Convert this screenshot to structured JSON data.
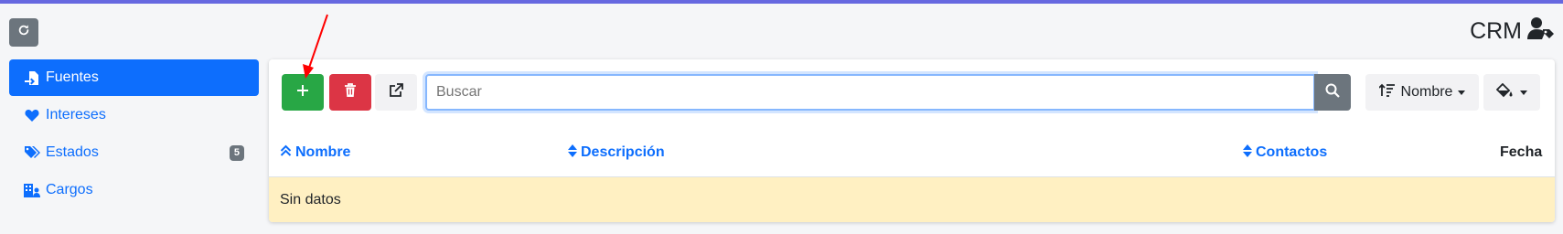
{
  "header": {
    "title": "CRM",
    "refresh_icon": "refresh-icon",
    "user_tag_icon": "user-tag-icon"
  },
  "sidebar": {
    "items": [
      {
        "label": "Fuentes",
        "icon": "file-import-icon",
        "active": true
      },
      {
        "label": "Intereses",
        "icon": "heart-icon",
        "active": false
      },
      {
        "label": "Estados",
        "icon": "tags-icon",
        "active": false,
        "badge": "5"
      },
      {
        "label": "Cargos",
        "icon": "building-user-icon",
        "active": false
      }
    ]
  },
  "toolbar": {
    "add_icon": "plus-icon",
    "delete_icon": "trash-icon",
    "export_icon": "external-link-icon",
    "search": {
      "placeholder": "Buscar",
      "value": ""
    },
    "search_icon": "search-icon",
    "sort_label": "Nombre",
    "paint_icon": "paint-bucket-icon"
  },
  "table": {
    "columns": [
      {
        "label": "Nombre",
        "sort": "ascending"
      },
      {
        "label": "Descripción",
        "sort": "sortable"
      },
      {
        "label": "Contactos",
        "sort": "sortable"
      },
      {
        "label": "Fecha",
        "sort": "none"
      }
    ],
    "empty_text": "Sin datos"
  },
  "colors": {
    "primary": "#0d6efd",
    "success": "#28a745",
    "danger": "#dc3545",
    "secondary": "#6c757d",
    "warning_light": "#fff0c2",
    "top_strip": "#6668e0",
    "annotation": "#ff0000"
  }
}
